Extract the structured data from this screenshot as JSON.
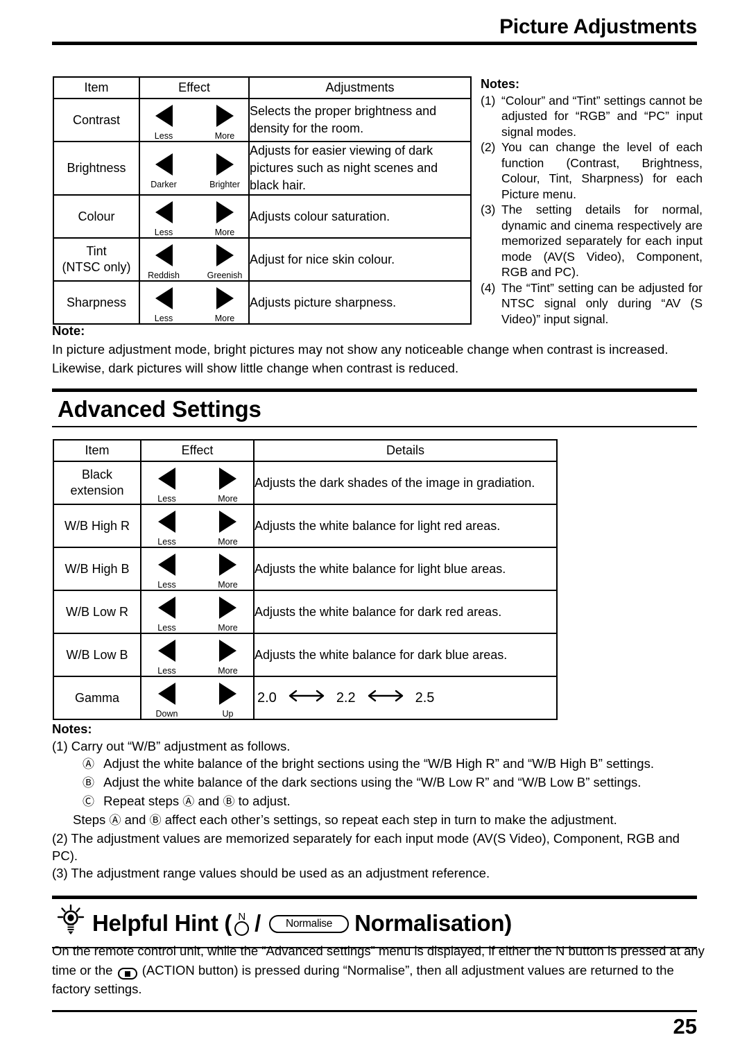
{
  "header": {
    "title": "Picture Adjustments"
  },
  "picture_table": {
    "columns": [
      "Item",
      "Effect",
      "Adjustments"
    ],
    "rows": [
      {
        "item": "Contrast",
        "left_label": "Less",
        "right_label": "More",
        "detail": "Selects the proper brightness and density for the room."
      },
      {
        "item": "Brightness",
        "left_label": "Darker",
        "right_label": "Brighter",
        "detail": "Adjusts for easier viewing of dark pictures such as night scenes and black hair."
      },
      {
        "item": "Colour",
        "left_label": "Less",
        "right_label": "More",
        "detail": "Adjusts colour saturation."
      },
      {
        "item": "Tint\n(NTSC only)",
        "item_line1": "Tint",
        "item_line2": "(NTSC only)",
        "left_label": "Reddish",
        "right_label": "Greenish",
        "detail": "Adjust for nice skin colour."
      },
      {
        "item": "Sharpness",
        "left_label": "Less",
        "right_label": "More",
        "detail": "Adjusts picture sharpness."
      }
    ]
  },
  "picture_notes": {
    "heading": "Notes:",
    "items": [
      {
        "num": "(1)",
        "text": "“Colour” and “Tint” settings cannot be adjusted for “RGB” and “PC” input signal modes."
      },
      {
        "num": "(2)",
        "text": "You can change the level of each function (Contrast, Brightness, Colour, Tint, Sharpness) for each Picture menu."
      },
      {
        "num": "(3)",
        "text": "The setting details for normal, dynamic and cinema respectively are memorized separately for each input mode (AV(S Video), Component, RGB and PC)."
      },
      {
        "num": "(4)",
        "text": "The “Tint” setting can be adjusted for NTSC signal only during “AV (S Video)” input signal."
      }
    ]
  },
  "picture_note_block": {
    "heading": "Note:",
    "line1": "In picture adjustment mode, bright pictures may not show any noticeable change when contrast is increased.",
    "line2": "Likewise, dark pictures will show little change when contrast is reduced."
  },
  "advanced_section": {
    "title": "Advanced Settings"
  },
  "advanced_table": {
    "columns": [
      "Item",
      "Effect",
      "Details"
    ],
    "rows": [
      {
        "item_line1": "Black",
        "item_line2": "extension",
        "left_label": "Less",
        "right_label": "More",
        "detail": "Adjusts the dark shades of the image in gradiation."
      },
      {
        "item_line1": "W/B High R",
        "item_line2": "",
        "left_label": "Less",
        "right_label": "More",
        "detail": "Adjusts the white balance for light red areas."
      },
      {
        "item_line1": "W/B High B",
        "item_line2": "",
        "left_label": "Less",
        "right_label": "More",
        "detail": "Adjusts the white balance for light blue areas."
      },
      {
        "item_line1": "W/B Low R",
        "item_line2": "",
        "left_label": "Less",
        "right_label": "More",
        "detail": "Adjusts the white balance for dark red areas."
      },
      {
        "item_line1": "W/B Low B",
        "item_line2": "",
        "left_label": "Less",
        "right_label": "More",
        "detail": "Adjusts the white balance for dark blue areas."
      },
      {
        "item_line1": "Gamma",
        "item_line2": "",
        "left_label": "Down",
        "right_label": "Up",
        "detail": "",
        "gamma": {
          "v1": "2.0",
          "v2": "2.2",
          "v3": "2.5",
          "arrow": "⟷"
        }
      }
    ]
  },
  "advanced_notes": {
    "heading": "Notes:",
    "n1": "(1) Carry out “W/B” adjustment as follows.",
    "step_a_mark": "Ⓐ",
    "step_a": "Adjust the white balance of the bright sections using the “W/B High R” and “W/B High B” settings.",
    "step_b_mark": "Ⓑ",
    "step_b": "Adjust the white balance of the dark sections using the “W/B Low R” and “W/B Low B” settings.",
    "step_c_mark": "Ⓒ",
    "step_c_pre": "Repeat steps",
    "step_c_mid": "and",
    "step_c_post": "to adjust.",
    "steps_line_pre": "Steps",
    "steps_line_mid": "and",
    "steps_line_post": "affect each other’s settings, so repeat each step in turn to make the adjustment.",
    "n2": "(2) The adjustment values are memorized separately for each input mode (AV(S Video), Component, RGB and PC).",
    "n3": "(3) The adjustment range values should be used as an adjustment reference."
  },
  "hint": {
    "icon": "lightbulb-icon",
    "title_pre": "Helpful Hint (",
    "n_button_label": "N",
    "slash": "/",
    "normalise_button": "Normalise",
    "title_post": "Normalisation)",
    "body_part1": "On the remote control unit, while the “Advanced settings” menu is displayed, if either the N button is pressed at any time or the",
    "body_part2": "(ACTION button) is pressed during “Normalise”, then all adjustment values are returned to the factory settings."
  },
  "footer": {
    "page_number": "25"
  }
}
